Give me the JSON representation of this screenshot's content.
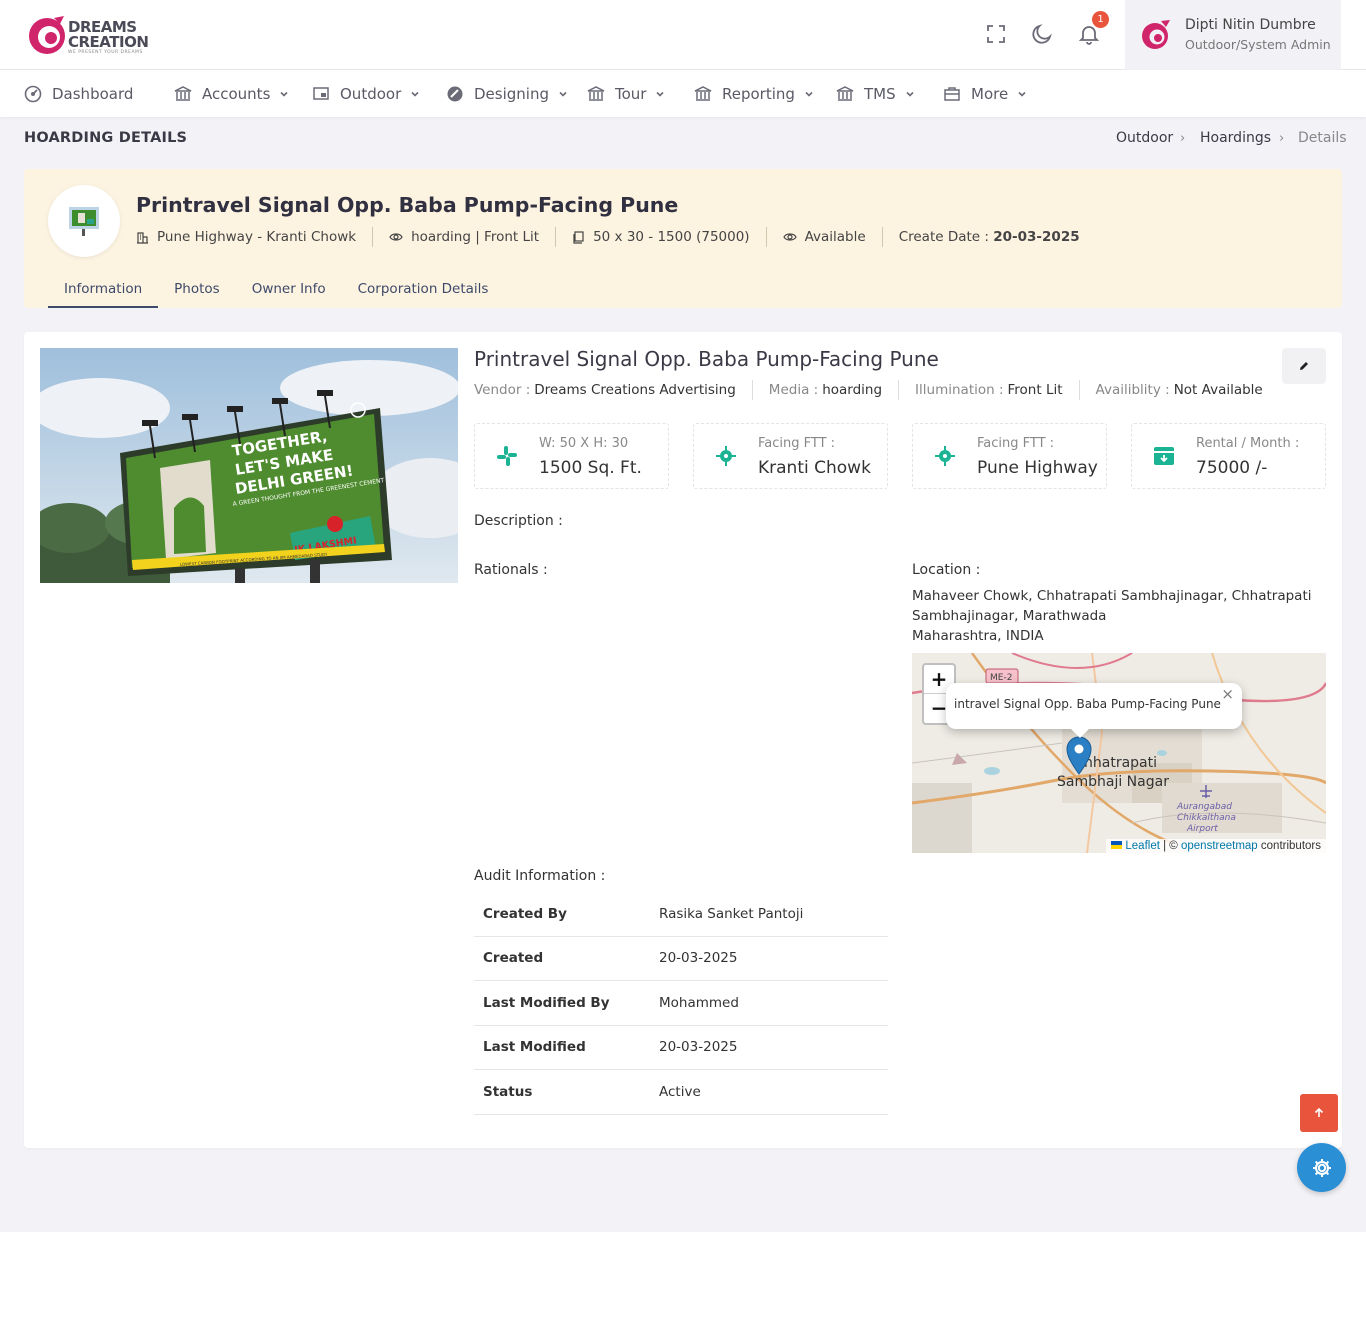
{
  "brand": {
    "name_line1": "DREAMS",
    "name_line2": "CREATION",
    "tagline": "WE PRESENT YOUR DREAMS",
    "accent": "#d0246b"
  },
  "header": {
    "notification_count": "1",
    "user": {
      "name": "Dipti Nitin Dumbre",
      "role": "Outdoor/System Admin"
    }
  },
  "nav": [
    {
      "label": "Dashboard",
      "icon": "dashboard-icon"
    },
    {
      "label": "Accounts",
      "icon": "bank-icon"
    },
    {
      "label": "Outdoor",
      "icon": "outdoor-icon"
    },
    {
      "label": "Designing",
      "icon": "design-icon"
    },
    {
      "label": "Tour",
      "icon": "bank-icon"
    },
    {
      "label": "Reporting",
      "icon": "bank-icon"
    },
    {
      "label": "TMS",
      "icon": "bank-icon"
    },
    {
      "label": "More",
      "icon": "briefcase-icon"
    }
  ],
  "page": {
    "title": "HOARDING DETAILS",
    "breadcrumb": [
      "Outdoor",
      "Hoardings",
      "Details"
    ]
  },
  "hero": {
    "title": "Printravel Signal Opp. Baba Pump-Facing Pune",
    "location": "Pune Highway - Kranti Chowk",
    "type": "hoarding | Front Lit",
    "size": "50 x 30 - 1500 (75000)",
    "status": "Available",
    "create_label": "Create Date :",
    "create_date": "20-03-2025",
    "tabs": [
      "Information",
      "Photos",
      "Owner Info",
      "Corporation Details"
    ]
  },
  "details": {
    "title": "Printravel Signal Opp. Baba Pump-Facing Pune",
    "vendor_label": "Vendor :",
    "vendor": "Dreams Creations Advertising",
    "media_label": "Media :",
    "media": "hoarding",
    "illum_label": "Illumination :",
    "illum": "Front Lit",
    "avail_label": "Availiblity :",
    "avail": "Not Available",
    "billboard": {
      "line1": "TOGETHER,",
      "line2": "LET'S MAKE",
      "line3": "DELHI GREEN!",
      "sub": "A GREEN THOUGHT FROM THE GREENEST CEMENT",
      "brand": "JK LAKSHMI",
      "footer": "LOWEST CARBON FOOTPRINT ACCORDING TO AN IIM AHMEDABAD STUDY"
    },
    "stats": [
      {
        "label": "W: 50 X H: 30",
        "value": "1500 Sq. Ft.",
        "icon": "slack-icon"
      },
      {
        "label": "Facing FTT :",
        "value": "Kranti Chowk",
        "icon": "crosshair-icon"
      },
      {
        "label": "Facing FTT :",
        "value": "Pune Highway",
        "icon": "crosshair-icon"
      },
      {
        "label": "Rental / Month :",
        "value": "75000 /-",
        "icon": "archive-icon"
      }
    ],
    "description_label": "Description :",
    "rationals_label": "Rationals :",
    "location_label": "Location :",
    "location_line1": "Mahaveer Chowk, Chhatrapati Sambhajinagar, Chhatrapati Sambhajinagar, Marathwada",
    "location_line2": "Maharashtra, INDIA",
    "map": {
      "popup": "intravel Signal Opp. Baba Pump-Facing Pune",
      "city_line1": "hhatrapati",
      "city_line2": "Sambhaji Nagar",
      "road_label": "ME-2",
      "airport_line1": "Aurangabad",
      "airport_line2": "Chikkalthana",
      "airport_line3": "Airport",
      "attrib_leaflet": "Leaflet",
      "attrib_sep": "| ©",
      "attrib_osm": "openstreetmap",
      "attrib_rest": "contributors",
      "zoom_in": "+",
      "zoom_out": "−"
    }
  },
  "audit": {
    "label": "Audit Information :",
    "rows": [
      {
        "k": "Created By",
        "v": "Rasika Sanket Pantoji"
      },
      {
        "k": "Created",
        "v": "20-03-2025"
      },
      {
        "k": "Last Modified By",
        "v": "Mohammed"
      },
      {
        "k": "Last Modified",
        "v": "20-03-2025"
      },
      {
        "k": "Status",
        "v": "Active"
      }
    ]
  }
}
